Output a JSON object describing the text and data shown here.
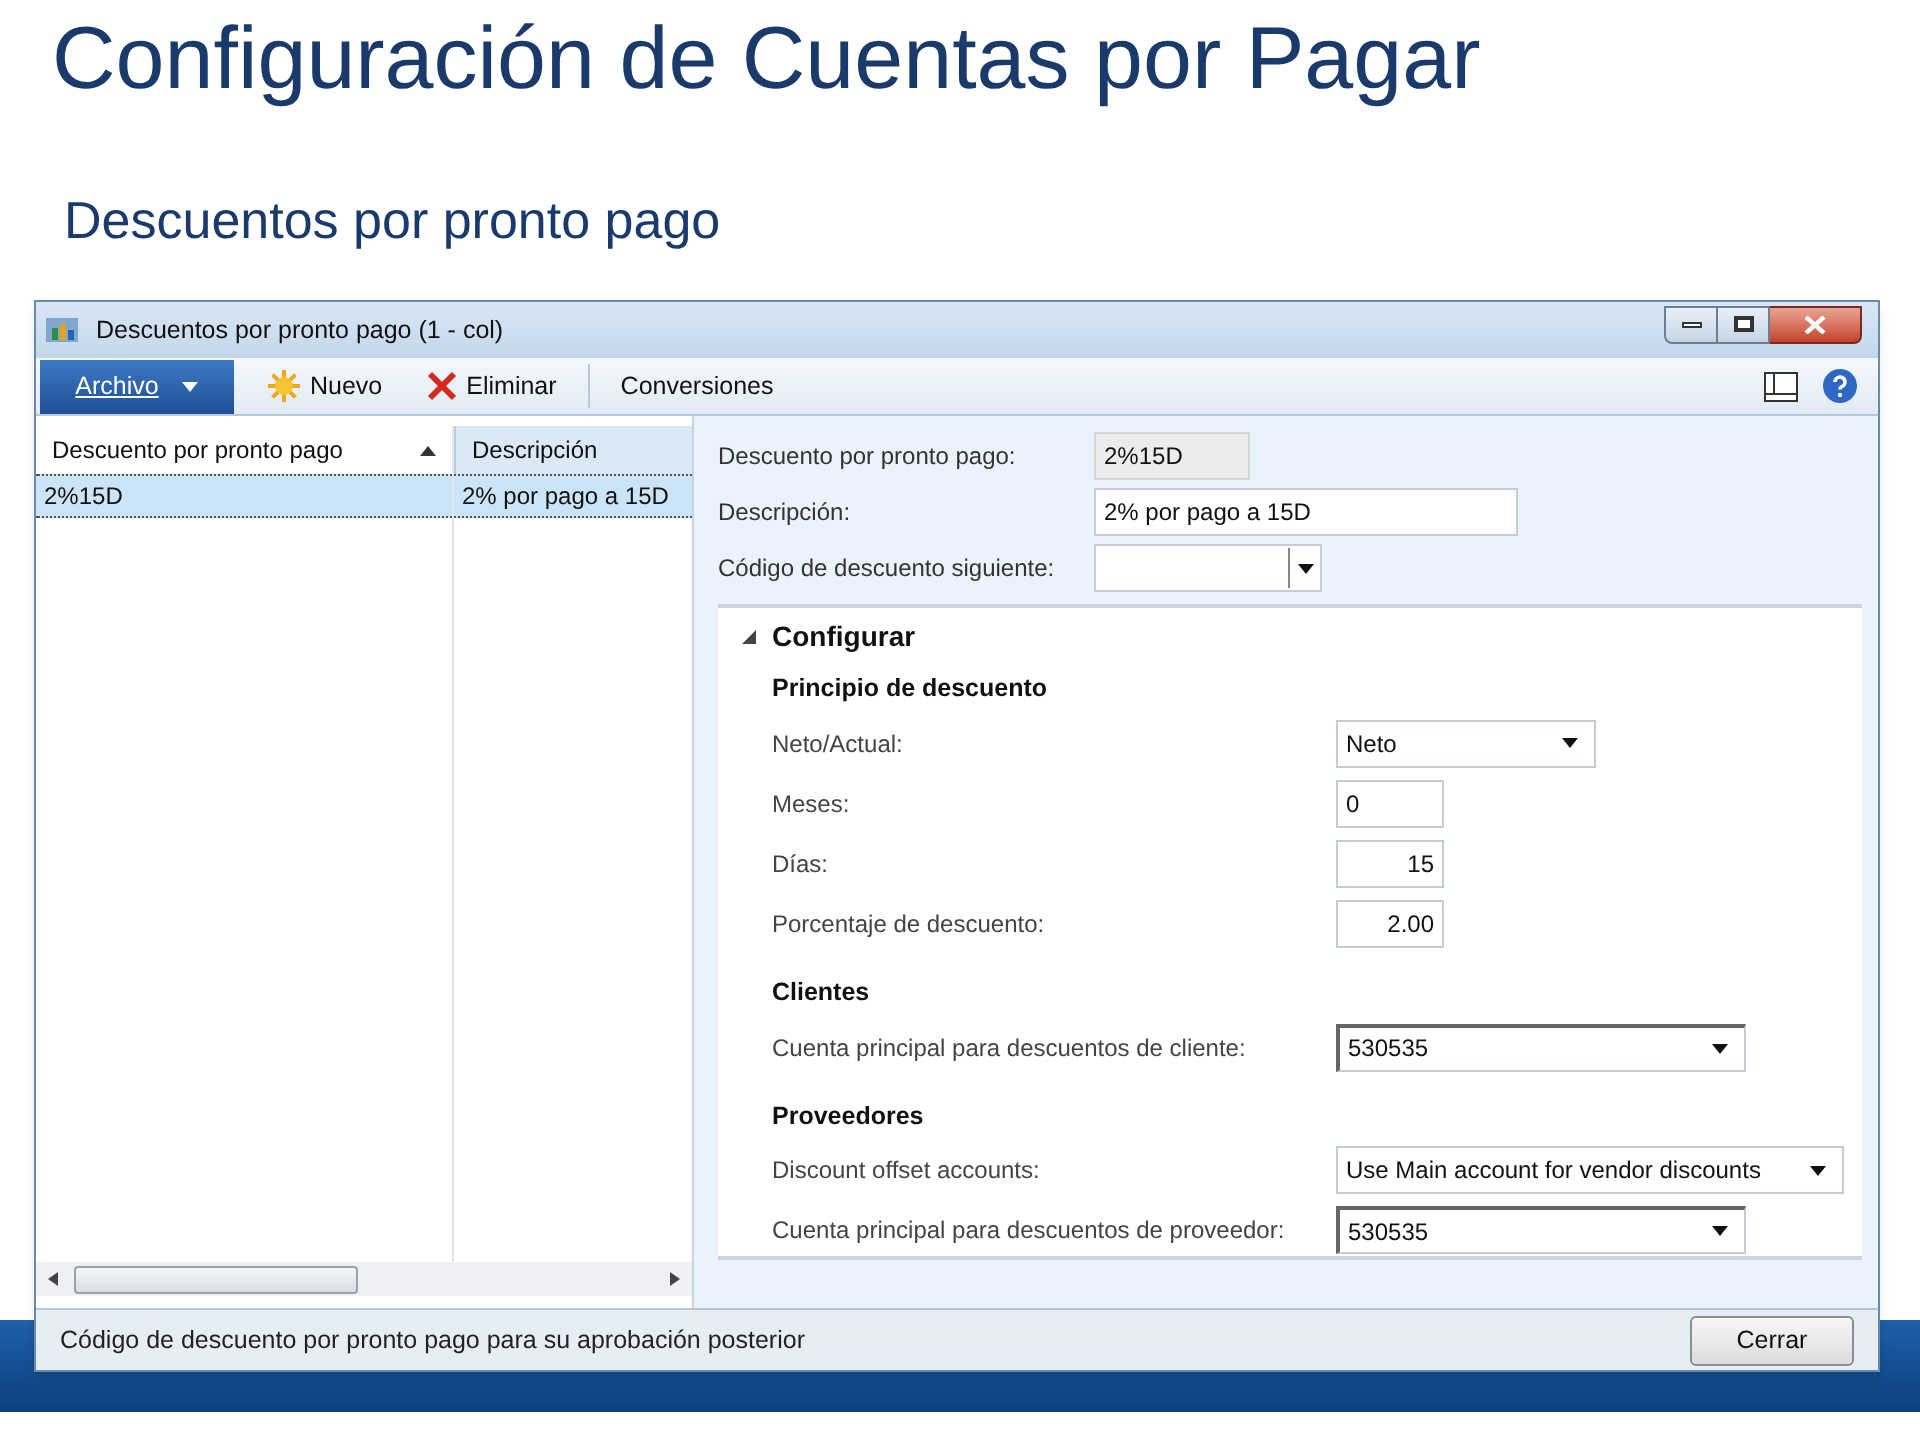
{
  "slide": {
    "title": "Configuración de Cuentas por Pagar",
    "subtitle": "Descuentos por pronto pago"
  },
  "window": {
    "title": "Descuentos por pronto pago (1 - col)"
  },
  "toolbar": [
    {
      "label": "Archivo",
      "kind": "menu"
    },
    {
      "label": "Nuevo",
      "kind": "new"
    },
    {
      "label": "Eliminar",
      "kind": "delete"
    },
    {
      "label": "Conversiones",
      "kind": "plain"
    }
  ],
  "grid": {
    "columns": [
      {
        "label": "Descuento por pronto pago",
        "sorted": true
      },
      {
        "label": "Descripción",
        "sorted": false
      }
    ],
    "rows": [
      {
        "cells": [
          "2%15D",
          "2% por pago a 15D"
        ],
        "selected": true
      }
    ]
  },
  "header_fields": [
    {
      "label": "Descuento por pronto pago:",
      "value": "2%15D",
      "kind": "readonly"
    },
    {
      "label": "Descripción:",
      "value": "2% por pago a 15D",
      "kind": "text"
    },
    {
      "label": "Código de descuento siguiente:",
      "kind": "combo"
    }
  ],
  "section": {
    "title": "Configurar",
    "expanded": true,
    "groups": [
      {
        "title": "Principio de descuento",
        "fields": [
          {
            "label": "Neto/Actual:",
            "value": "Neto",
            "kind": "dropdown"
          },
          {
            "label": "Meses:",
            "value": "0",
            "kind": "text"
          },
          {
            "label": "Días:",
            "value": "15",
            "kind": "number"
          },
          {
            "label": "Porcentaje de descuento:",
            "value": "2.00",
            "kind": "number"
          }
        ]
      },
      {
        "title": "Clientes",
        "fields": [
          {
            "label": "Cuenta principal para descuentos de cliente:",
            "value": "530535",
            "kind": "lookup"
          }
        ]
      },
      {
        "title": "Proveedores",
        "fields": [
          {
            "label": "Discount offset accounts:",
            "value": "Use Main account for vendor discounts",
            "kind": "wide-dropdown"
          },
          {
            "label": "Cuenta principal para descuentos de proveedor:",
            "value": "530535",
            "kind": "lookup"
          }
        ]
      }
    ]
  },
  "status_bar": {
    "text": "Código de descuento por pronto pago para su aprobación posterior",
    "button": "Cerrar"
  }
}
